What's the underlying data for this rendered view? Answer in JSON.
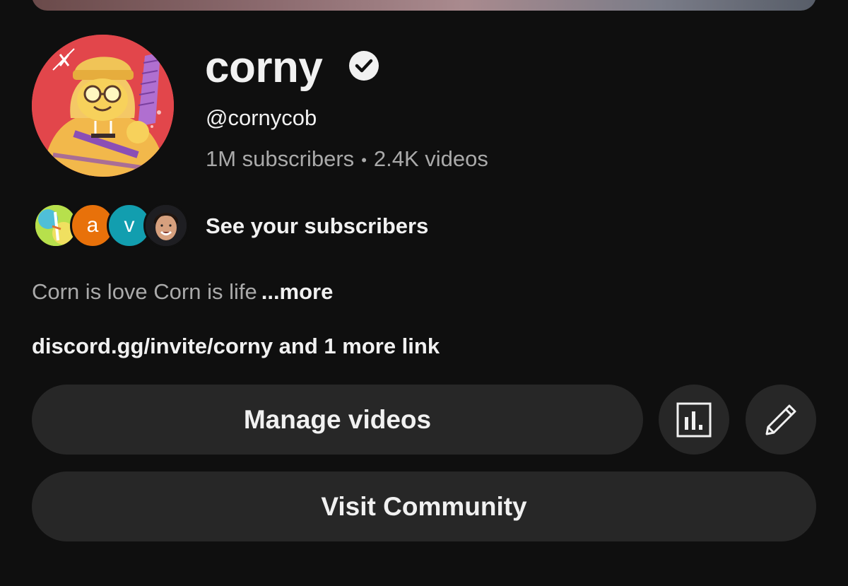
{
  "channel": {
    "name": "corny",
    "handle": "@cornycob",
    "subscribers": "1M subscribers",
    "separator": "•",
    "videos": "2.4K videos",
    "verified_icon": "verified-check-icon"
  },
  "subscribers_row": {
    "avatars": [
      {
        "kind": "image",
        "icon": "subscriber-avatar-image-1"
      },
      {
        "kind": "letter",
        "letter": "a",
        "color": "#e8710a"
      },
      {
        "kind": "letter",
        "letter": "v",
        "color": "#129eaf"
      },
      {
        "kind": "image",
        "icon": "subscriber-avatar-photo"
      }
    ],
    "label": "See your subscribers"
  },
  "description": {
    "text": "Corn is love Corn is life",
    "more": "...more"
  },
  "links": {
    "text": "discord.gg/invite/corny and 1 more link"
  },
  "actions": {
    "manage_videos": "Manage videos",
    "analytics_icon": "analytics-icon",
    "edit_icon": "pencil-icon",
    "visit_community": "Visit Community"
  },
  "colors": {
    "background": "#0f0f0f",
    "button": "#272727",
    "text_primary": "#f1f1f1",
    "text_secondary": "#aaaaaa",
    "avatar_bg": "#e2464b"
  }
}
